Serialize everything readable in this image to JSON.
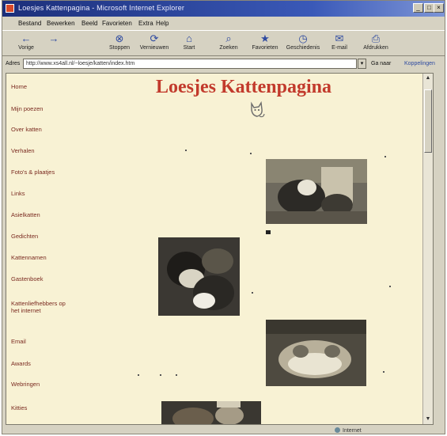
{
  "window": {
    "title": "Loesjes Kattenpagina - Microsoft Internet Explorer"
  },
  "menubar": {
    "items": [
      "Bestand",
      "Bewerken",
      "Beeld",
      "Favorieten",
      "Extra",
      "Help"
    ]
  },
  "toolbar": {
    "buttons": [
      {
        "label": "Vorige",
        "icon": "back-arrow-icon"
      },
      {
        "label": "",
        "icon": "forward-arrow-icon"
      },
      {
        "label": "Stoppen",
        "icon": "stop-icon"
      },
      {
        "label": "Vernieuwen",
        "icon": "refresh-icon"
      },
      {
        "label": "Start",
        "icon": "home-icon"
      },
      {
        "label": "Zoeken",
        "icon": "search-icon"
      },
      {
        "label": "Favorieten",
        "icon": "favorites-icon"
      },
      {
        "label": "Geschiedenis",
        "icon": "history-icon"
      },
      {
        "label": "E-mail",
        "icon": "mail-icon"
      },
      {
        "label": "Afdrukken",
        "icon": "print-icon"
      }
    ]
  },
  "addressbar": {
    "label": "Adres",
    "url": "http://www.xs4all.nl/~loesje/katten/index.htm",
    "go_label": "Ga naar",
    "links_label": "Koppelingen"
  },
  "page": {
    "title": "Loesjes Kattenpagina"
  },
  "sidebar": {
    "items": [
      "Home",
      "Mijn poezen",
      "Over katten",
      "Verhalen",
      "Foto's & plaatjes",
      "Links",
      "Asielkatten",
      "Gedichten",
      "Kattennamen",
      "Gastenboek",
      "Kattenliefhebbers op het internet",
      "Email",
      "Awards",
      "Webringen",
      "Kitties"
    ]
  },
  "statusbar": {
    "zone": "Internet"
  },
  "colors": {
    "title": "#c23a2c",
    "page_background": "#f8f2d4",
    "nav_link": "#7a2a20"
  }
}
